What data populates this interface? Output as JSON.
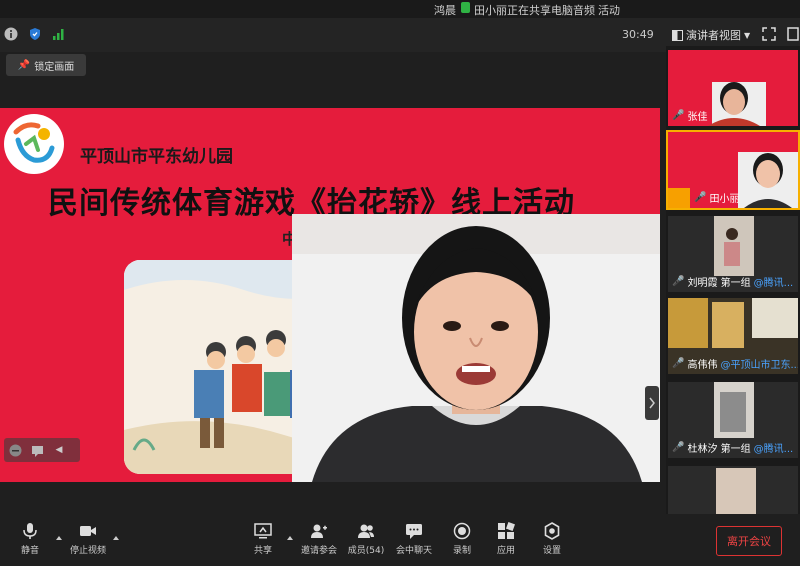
{
  "notification": {
    "name": "鸿晨",
    "sharing": "田小丽正在共享电脑音频",
    "suffix": "活动"
  },
  "titlebar": {
    "timer": "30:49",
    "view_label": "演讲者视图"
  },
  "lock_label": "锁定画面",
  "slide": {
    "school": "平顶山市平东幼儿园",
    "title": "民间传统体育游戏《抬花轿》线上活动",
    "class": "中二班"
  },
  "participants": [
    {
      "name": "张佳",
      "extra": ""
    },
    {
      "name": "田小丽",
      "extra": ""
    },
    {
      "name": "刘明霞 第一组",
      "extra": "@腾讯..."
    },
    {
      "name": "高伟伟",
      "extra": "@平顶山市卫东..."
    },
    {
      "name": "杜林汐 第一组",
      "extra": "@腾讯..."
    },
    {
      "name": "",
      "extra": ""
    }
  ],
  "toolbar": {
    "mute": "静音",
    "stop_video": "停止视频",
    "share": "共享",
    "invite": "邀请参会",
    "members": "成员(54)",
    "chat": "会中聊天",
    "record": "录制",
    "apps": "应用",
    "settings": "设置",
    "leave": "离开会议"
  },
  "colors": {
    "slide_bg": "#e51c3c",
    "active_speaker": "#f7b000",
    "leave": "#dd3333",
    "share_dot": "#2fb344"
  }
}
